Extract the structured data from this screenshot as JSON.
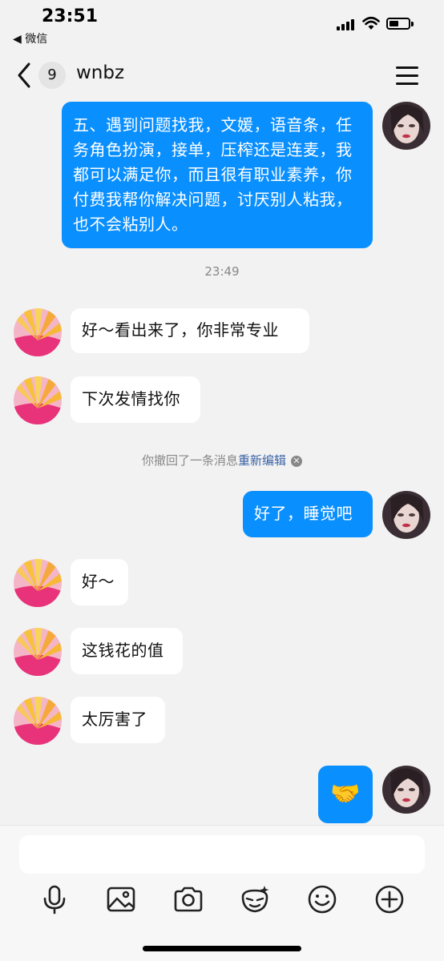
{
  "status_bar": {
    "time": "23:51",
    "back_app": "◀ 微信"
  },
  "header": {
    "unread_count": "9",
    "title": "wnbz"
  },
  "messages": [
    {
      "side": "out",
      "text": "五、遇到问题找我，文媛，语音条，任务角色扮演，接单，压榨还是连麦，我都可以满足你，而且很有职业素养，你付费我帮你解决问题，讨厌别人粘我，也不会粘别人。"
    },
    {
      "type": "timestamp",
      "text": "23:49"
    },
    {
      "side": "in",
      "text": "好～看出来了，你非常专业"
    },
    {
      "side": "in",
      "text": "下次发情找你"
    },
    {
      "type": "recall",
      "text": "你撤回了一条消息",
      "action": "重新编辑"
    },
    {
      "side": "out",
      "text": "好了，睡觉吧"
    },
    {
      "side": "in",
      "text": "好～"
    },
    {
      "side": "in",
      "text": "这钱花的值"
    },
    {
      "side": "in",
      "text": "太厉害了"
    },
    {
      "side": "out",
      "type": "emoji",
      "text": "🤝"
    }
  ],
  "toolbar": {
    "icons": [
      "microphone-icon",
      "image-icon",
      "camera-icon",
      "sticker-icon",
      "emoji-icon",
      "plus-icon"
    ]
  },
  "colors": {
    "outgoing_bubble": "#0a8fff",
    "incoming_bubble": "#ffffff",
    "background": "#f2f2f2"
  }
}
